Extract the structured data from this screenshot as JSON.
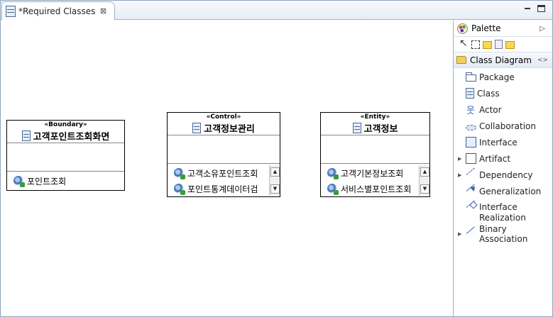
{
  "editor": {
    "tab_title": "*Required Classes",
    "tab_close": "⊠",
    "minimize_icon": "minimize-icon",
    "maximize_icon": "maximize-icon"
  },
  "diagram": {
    "classes": [
      {
        "stereotype": "«Boundary»",
        "name": "고객포인트조회화면",
        "operations": [
          "포인트조회"
        ],
        "has_scrollbar": false
      },
      {
        "stereotype": "«Control»",
        "name": "고객정보관리",
        "operations": [
          "고객소유포인트조회",
          "포인트통계데이터검"
        ],
        "has_scrollbar": true
      },
      {
        "stereotype": "«Entity»",
        "name": "고객정보",
        "operations": [
          "고객기본정보조회",
          "서비스별포인트조회"
        ],
        "has_scrollbar": true
      }
    ]
  },
  "palette": {
    "title": "Palette",
    "toggle": "▷",
    "tools": [
      "select-tool-icon",
      "marquee-tool-icon",
      "note-tool-icon",
      "text-tool-icon",
      "attachment-tool-icon"
    ],
    "drawer": {
      "label": "Class Diagram",
      "pin": "<>"
    },
    "items": [
      {
        "label": "Package",
        "icon": "package-icon",
        "expandable": false
      },
      {
        "label": "Class",
        "icon": "class-icon",
        "expandable": false
      },
      {
        "label": "Actor",
        "icon": "actor-icon",
        "expandable": false
      },
      {
        "label": "Collaboration",
        "icon": "collaboration-icon",
        "expandable": false
      },
      {
        "label": "Interface",
        "icon": "interface-icon",
        "expandable": false
      },
      {
        "label": "Artifact",
        "icon": "artifact-icon",
        "expandable": true
      },
      {
        "label": "Dependency",
        "icon": "dependency-icon",
        "expandable": true
      },
      {
        "label": "Generalization",
        "icon": "generalization-icon",
        "expandable": false
      },
      {
        "label": "Interface",
        "label2": "Realization",
        "icon": "interface-realization-icon",
        "expandable": false
      },
      {
        "label": "Binary Association",
        "icon": "binary-association-icon",
        "expandable": true
      }
    ]
  }
}
